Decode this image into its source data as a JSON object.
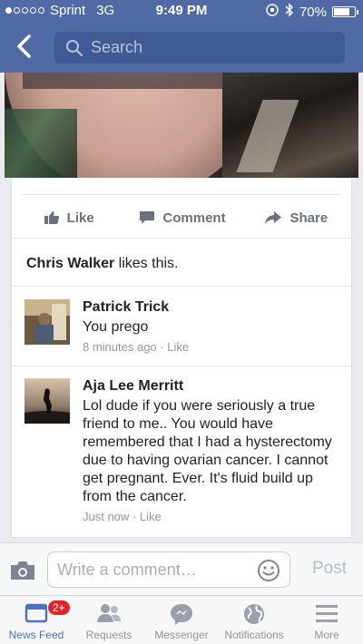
{
  "status_bar": {
    "carrier": "Sprint",
    "network": "3G",
    "time": "9:49 PM",
    "battery": "70%"
  },
  "nav": {
    "search_placeholder": "Search"
  },
  "post": {
    "actions": {
      "like": "Like",
      "comment": "Comment",
      "share": "Share"
    },
    "likes": {
      "name": "Chris Walker",
      "suffix": " likes this."
    }
  },
  "comments": [
    {
      "name": "Patrick Trick",
      "text": "You prego",
      "time": "8 minutes ago",
      "like": "Like"
    },
    {
      "name": "Aja Lee Merritt",
      "text": "Lol dude if you were seriously a true friend to me.. You would have remembered that I had a hysterectomy due to having ovarian cancer. I cannot get pregnant. Ever. It's fluid build up from the cancer.",
      "time": "Just now",
      "like": "Like"
    }
  ],
  "composer": {
    "placeholder": "Write a comment…",
    "post_label": "Post"
  },
  "tabbar": [
    {
      "label": "News Feed",
      "badge": "2+"
    },
    {
      "label": "Requests"
    },
    {
      "label": "Messenger"
    },
    {
      "label": "Notifications"
    },
    {
      "label": "More"
    }
  ],
  "colors": {
    "brand": "#4f6aa4",
    "active_tab": "#4a73c4",
    "badge": "#e0262b"
  }
}
